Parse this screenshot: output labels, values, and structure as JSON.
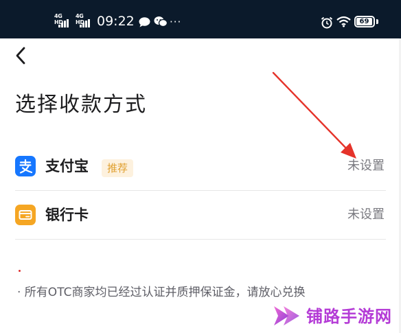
{
  "status_bar": {
    "network_1": "4G HD",
    "network_2": "4G HD",
    "time": "09:22",
    "more": "···",
    "battery": "69"
  },
  "nav": {
    "back_icon": "chevron-left-icon"
  },
  "page": {
    "title": "选择收款方式"
  },
  "payment_methods": [
    {
      "icon": "alipay-icon",
      "name": "支付宝",
      "tag": "推荐",
      "status": "未设置",
      "accent": "#1677ff"
    },
    {
      "icon": "bank-card-icon",
      "name": "银行卡",
      "status": "未设置",
      "accent": "#f5a623"
    }
  ],
  "notes": {
    "marker": ".",
    "text": "· 所有OTC商家均已经过认证并质押保证金，请放心兑换"
  },
  "annotation": {
    "arrow_color": "#e5332a"
  },
  "watermark": {
    "text": "铺路手游网",
    "color": "#b43bd6"
  }
}
